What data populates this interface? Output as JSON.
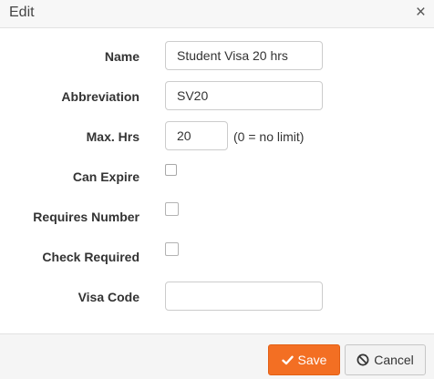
{
  "dialog": {
    "title": "Edit",
    "close_glyph": "×"
  },
  "form": {
    "name": {
      "label": "Name",
      "value": "Student Visa 20 hrs"
    },
    "abbreviation": {
      "label": "Abbreviation",
      "value": "SV20"
    },
    "max_hrs": {
      "label": "Max. Hrs",
      "value": "20",
      "hint": "(0 = no limit)"
    },
    "can_expire": {
      "label": "Can Expire",
      "checked": false
    },
    "requires_number": {
      "label": "Requires Number",
      "checked": false
    },
    "check_required": {
      "label": "Check Required",
      "checked": false
    },
    "visa_code": {
      "label": "Visa Code",
      "value": ""
    }
  },
  "footer": {
    "save_label": "Save",
    "save_icon": "checkmark-icon",
    "cancel_label": "Cancel",
    "cancel_icon": "ban-icon"
  },
  "colors": {
    "accent": "#f36f23",
    "title_bar": "#f7f7f7",
    "footer_bg": "#f5f5f5"
  }
}
